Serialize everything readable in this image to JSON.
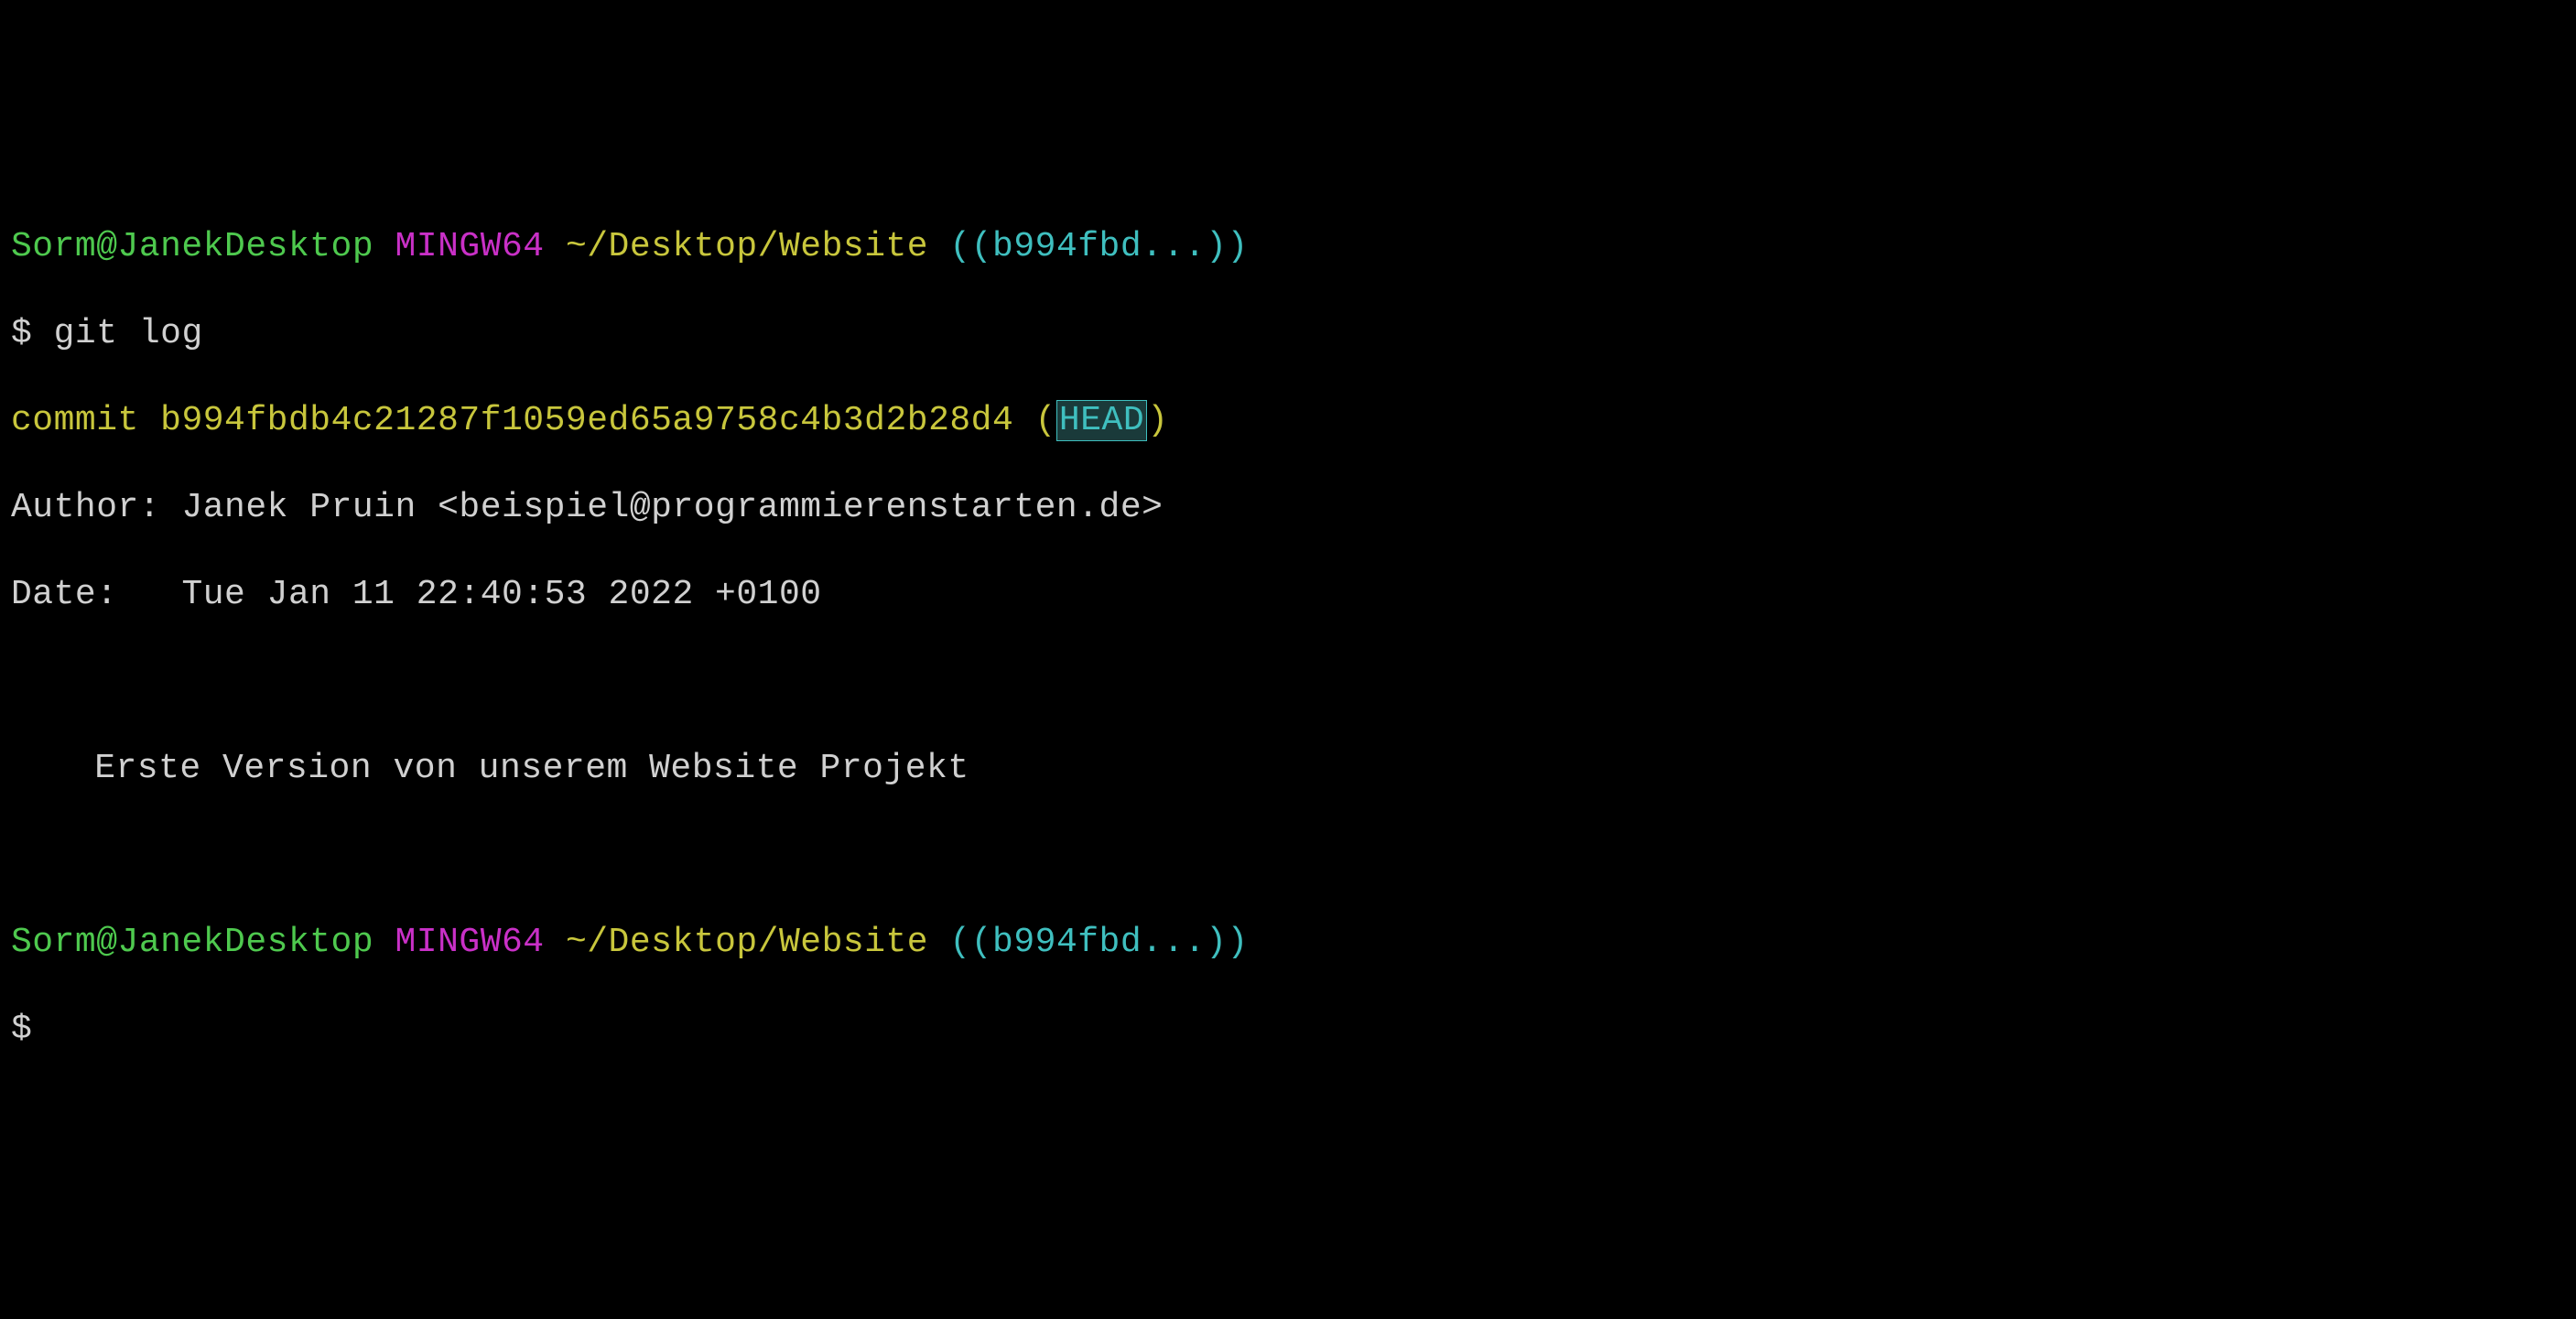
{
  "prompt1": {
    "user_host": "Sorm@JanekDesktop",
    "env": "MINGW64",
    "path": "~/Desktop/Website",
    "branch_open": "((",
    "branch_ref": "b994fbd...",
    "branch_close": "))",
    "prompt_symbol": "$",
    "command": "git log"
  },
  "log": {
    "commit_label": "commit",
    "commit_hash": "b994fbdb4c21287f1059ed65a9758c4b3d2b28d4",
    "ref_open": "(",
    "head": "HEAD",
    "ref_close": ")",
    "author_label": "Author:",
    "author_name": "Janek Pruin",
    "author_email_open": "<",
    "author_email": "beispiel@programmierenstarten.de",
    "author_email_close": ">",
    "date_label": "Date:",
    "date_value": "Tue Jan 11 22:40:53 2022 +0100",
    "message": "Erste Version von unserem Website Projekt"
  },
  "prompt2": {
    "user_host": "Sorm@JanekDesktop",
    "env": "MINGW64",
    "path": "~/Desktop/Website",
    "branch_open": "((",
    "branch_ref": "b994fbd...",
    "branch_close": "))",
    "prompt_symbol": "$"
  }
}
